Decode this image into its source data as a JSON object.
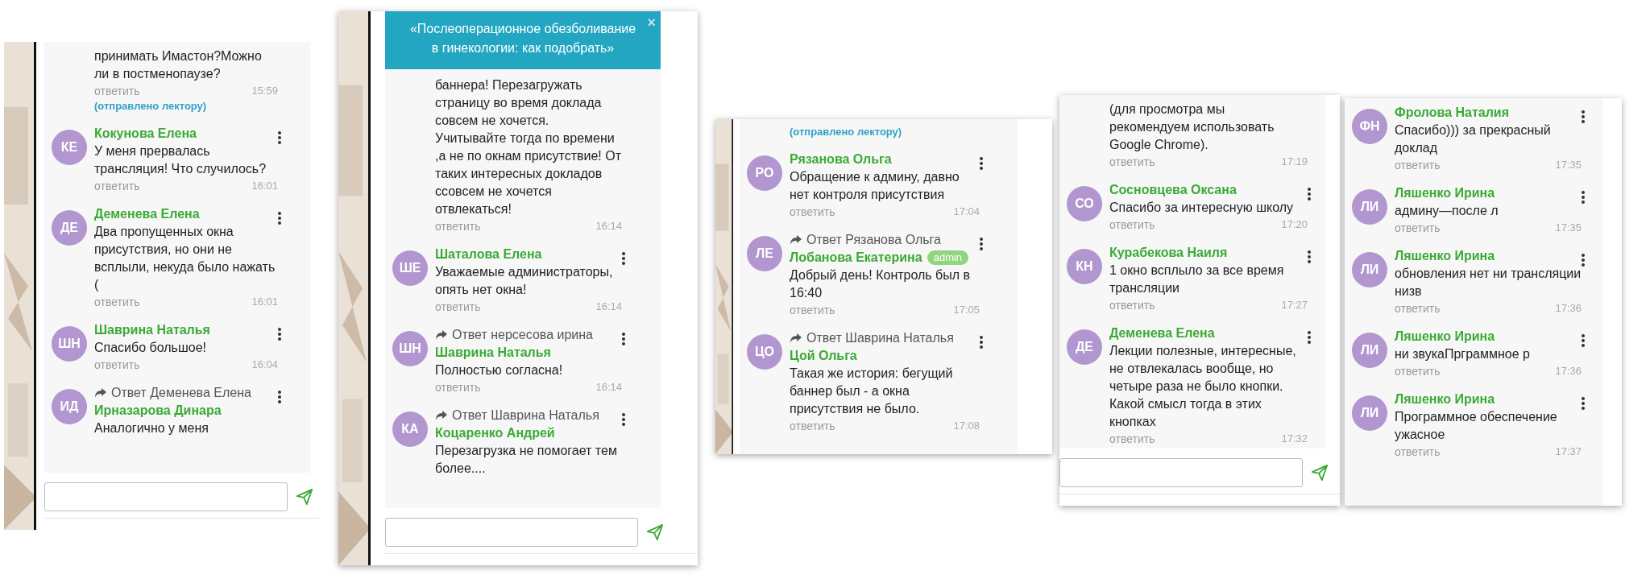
{
  "panels": [
    {
      "side_picture": true,
      "composer": true,
      "messages": [
        {
          "text": "принимать Имастон?Можно ли в постменопаузе?",
          "reply_label": "ответить",
          "time": "15:59",
          "note": "(отправлено лектору)"
        },
        {
          "initials": "КЕ",
          "author": "Кокунова Елена",
          "text": "У меня прервалась трансляция! Что случилось?",
          "reply_label": "ответить",
          "time": "16:01"
        },
        {
          "initials": "ДЕ",
          "author": "Деменева Елена",
          "text": "Два пропущенных окна присутствия, но они не всплыли, некуда было нажать (",
          "reply_label": "ответить",
          "time": "16:01"
        },
        {
          "initials": "ШН",
          "author": "Шаврина Наталья",
          "text": "Спасибо большое!",
          "reply_label": "ответить",
          "time": "16:04"
        },
        {
          "initials": "ИД",
          "reply_to": "Ответ Деменева Елена",
          "author": "Ирназарова Динара",
          "text": "Аналогично у меня"
        }
      ]
    },
    {
      "side_picture": true,
      "banner": {
        "text": "«Послеоперационное обезболивание в гинекологии: как подобрать»",
        "close": "×"
      },
      "composer": true,
      "messages": [
        {
          "text": "баннера! Перезагружать страницу во время доклада совсем не хочется. Учитывайте тогда по времени ,а не по окнам присутствие! От таких интересных докладов ссовсем не хочется отвлекаться!",
          "reply_label": "ответить",
          "time": "16:14"
        },
        {
          "initials": "ШЕ",
          "author": "Шаталова Елена",
          "text": "Уважаемые администраторы, опять нет окна!",
          "reply_label": "ответить",
          "time": "16:14"
        },
        {
          "initials": "ШН",
          "reply_to": "Ответ нерсесова ирина",
          "author": "Шаврина Наталья",
          "text": "Полностью согласна!",
          "reply_label": "ответить",
          "time": "16:14"
        },
        {
          "initials": "КА",
          "reply_to": "Ответ Шаврина Наталья",
          "author": "Коцаренко Андрей",
          "text": "Перезагрузка не помогает тем более...."
        }
      ]
    },
    {
      "side_picture": true,
      "composer": false,
      "messages": [
        {
          "note": "(отправлено лектору)"
        },
        {
          "initials": "РО",
          "author": "Рязанова Ольга",
          "text": "Обращение к админу, давно нет контроля присутствия",
          "reply_label": "ответить",
          "time": "17:04"
        },
        {
          "initials": "ЛЕ",
          "reply_to": "Ответ Рязанова Ольга",
          "author": "Лобанова Екатерина",
          "badge": "admin",
          "text": "Добрый день! Контроль был в 16:40",
          "reply_label": "ответить",
          "time": "17:05"
        },
        {
          "initials": "ЦО",
          "reply_to": "Ответ Шаврина Наталья",
          "author": "Цой Ольга",
          "text": "Такая же история: бегущий баннер был - а окна присутствия не было.",
          "reply_label": "ответить",
          "time": "17:08"
        }
      ]
    },
    {
      "side_picture": false,
      "composer": true,
      "messages": [
        {
          "text": "(для просмотра мы рекомендуем использовать Google Chrome).",
          "reply_label": "ответить",
          "time": "17:19"
        },
        {
          "initials": "СО",
          "author": "Сосновцева Оксана",
          "text": "Спасибо за интересную школу",
          "reply_label": "ответить",
          "time": "17:20"
        },
        {
          "initials": "КН",
          "author": "Курабекова Наиля",
          "text": "1 окно всплыло за все время трансляции",
          "reply_label": "ответить",
          "time": "17:27"
        },
        {
          "initials": "ДЕ",
          "author": "Деменева Елена",
          "text": "Лекции полезные, интересные, не отвлекалась вообще, но четыре раза не было кнопки. Какой смысл тогда в этих кнопках",
          "reply_label": "ответить",
          "time": "17:32"
        }
      ]
    },
    {
      "side_picture": false,
      "composer": false,
      "messages": [
        {
          "initials": "ФН",
          "author": "Фролова Наталия",
          "text": "Спасибо))) за прекрасный доклад",
          "reply_label": "ответить",
          "time": "17:35"
        },
        {
          "initials": "ЛИ",
          "author": "Ляшенко Ирина",
          "text": "админу—после л",
          "reply_label": "ответить",
          "time": "17:35"
        },
        {
          "initials": "ЛИ",
          "author": "Ляшенко Ирина",
          "text": "обновления нет ни трансляции низв",
          "reply_label": "ответить",
          "time": "17:36"
        },
        {
          "initials": "ЛИ",
          "author": "Ляшенко Ирина",
          "text": "ни звукаПрграммное р",
          "reply_label": "ответить",
          "time": "17:36"
        },
        {
          "initials": "ЛИ",
          "author": "Ляшенко Ирина",
          "text": "Программное обеспечение ужасное",
          "reply_label": "ответить",
          "time": "17:37"
        }
      ]
    }
  ]
}
